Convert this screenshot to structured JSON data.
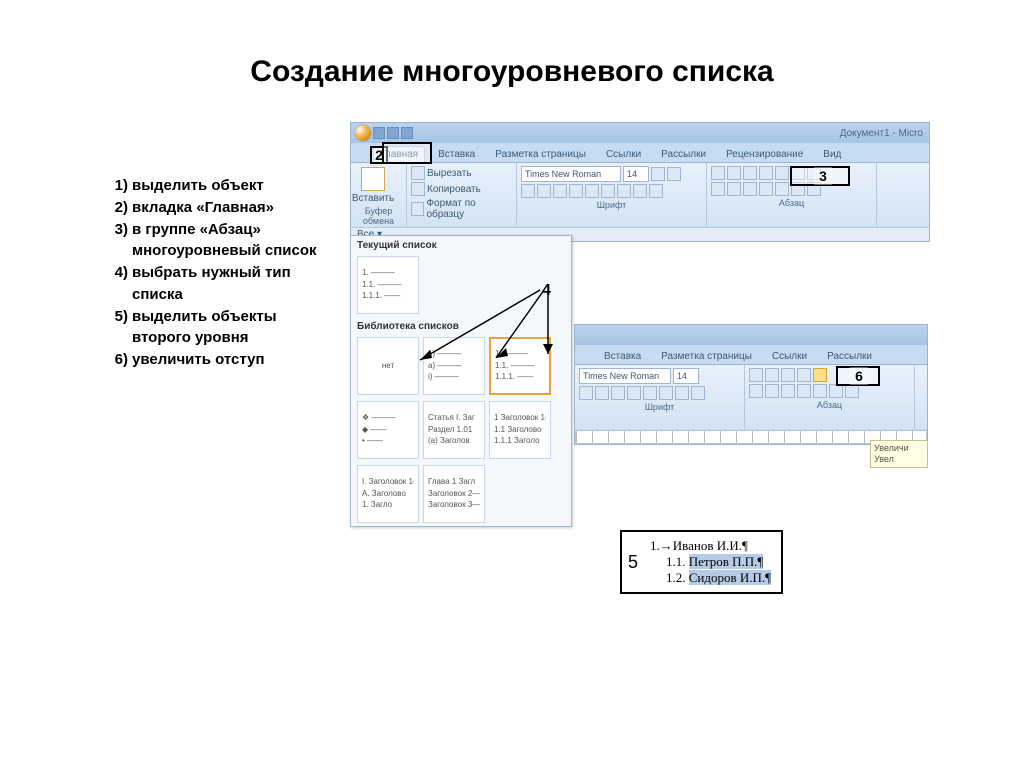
{
  "title": "Создание многоуровневого списка",
  "instructions": [
    "выделить объект",
    "вкладка «Главная»",
    "в группе «Абзац» многоуровневый список",
    "выбрать нужный тип списка",
    "выделить объекты второго уровня",
    "увеличить отступ"
  ],
  "ribbon": {
    "doc_title": "Документ1 - Micro",
    "tabs": [
      "Главная",
      "Вставка",
      "Разметка страницы",
      "Ссылки",
      "Рассылки",
      "Рецензирование",
      "Вид"
    ],
    "active_tab": "Главная",
    "paste": "Вставить",
    "clipboard_group": "Буфер обмена",
    "font_group": "Шрифт",
    "para_group": "Абзац",
    "cut": "Вырезать",
    "copy": "Копировать",
    "format_painter": "Формат по образцу",
    "font_name": "Times New Roman",
    "font_size": "14",
    "all_btn": "Все ▾"
  },
  "ribbon2": {
    "tabs": [
      "Вставка",
      "Разметка страницы",
      "Ссылки",
      "Рассылки"
    ],
    "font_name": "Times New Roman",
    "font_size": "14",
    "font_group": "Шрифт",
    "para_group": "Абзац"
  },
  "dropdown": {
    "current_label": "Текущий список",
    "library_label": "Библиотека списков",
    "current": [
      "1. ———",
      "1.1. ———",
      "1.1.1. ——"
    ],
    "lib": [
      {
        "c": [
          "",
          "нет",
          ""
        ]
      },
      {
        "c": [
          "1) ———",
          "a) ———",
          "i) ———"
        ]
      },
      {
        "c": [
          "1. ———",
          "1.1. ———",
          "1.1.1. ——"
        ],
        "sel": true
      },
      {
        "c": [
          "❖ ———",
          "  ◆ ——",
          "    • ——"
        ]
      },
      {
        "c": [
          "Статья I. Заг",
          "Раздел 1.01",
          "(a) Заголов"
        ]
      },
      {
        "c": [
          "1 Заголовок 1—",
          "1.1 Заголово",
          "1.1.1 Заголо"
        ]
      },
      {
        "c": [
          "I. Заголовок 1—",
          "A. Заголово",
          "1. Загло"
        ]
      },
      {
        "c": [
          "Глава 1 Загл",
          "Заголовок 2—",
          "Заголовок 3—"
        ]
      }
    ]
  },
  "annotations": {
    "a2": "2",
    "a3": "3",
    "a4": "4",
    "a5": "5",
    "a6": "6"
  },
  "sample5": {
    "l1": "1.→Иванов И.И.¶",
    "l2": "1.1.",
    "l2t": "Петров П.П.¶",
    "l3": "1.2.",
    "l3t": "Сидоров И.П.¶"
  },
  "tooltip6": {
    "t1": "Увеличи",
    "t2": "Увел"
  }
}
